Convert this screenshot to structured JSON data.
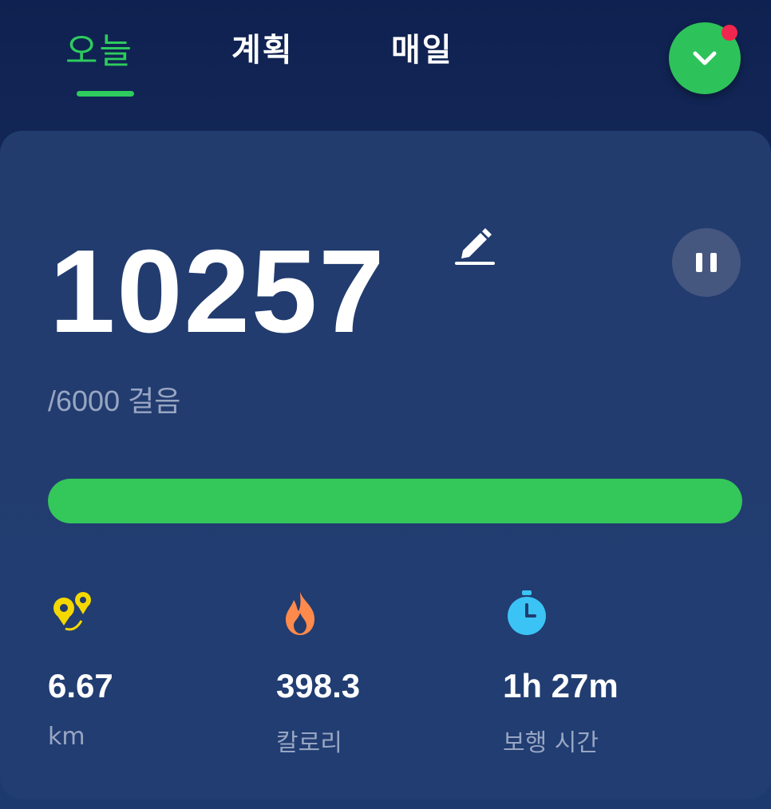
{
  "tabs": [
    {
      "label": "오늘",
      "active": true
    },
    {
      "label": "계획",
      "active": false
    },
    {
      "label": "매일",
      "active": false
    }
  ],
  "colors": {
    "accent": "#2ecb5e",
    "progress": "#34c759",
    "notification": "#f0264e",
    "distance_icon": "#f5d800",
    "calorie_icon": "#ff8a4c",
    "time_icon": "#3bc3f5"
  },
  "summary": {
    "steps": "10257",
    "goal_text": "/6000 걸음",
    "progress_fraction": 1.0
  },
  "stats": [
    {
      "icon": "route-pin-icon",
      "value": "6.67",
      "label": "km"
    },
    {
      "icon": "flame-icon",
      "value": "398.3",
      "label": "칼로리"
    },
    {
      "icon": "stopwatch-icon",
      "value": "1h 27m",
      "label": "보행 시간"
    }
  ]
}
